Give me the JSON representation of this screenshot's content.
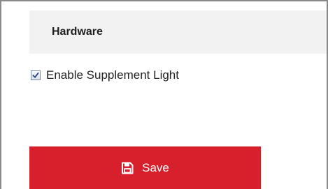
{
  "section": {
    "title": "Hardware"
  },
  "options": {
    "supplement_light": {
      "label": "Enable Supplement Light",
      "checked": true
    }
  },
  "actions": {
    "save_label": "Save",
    "save_icon": "floppy-disk-icon"
  },
  "colors": {
    "save_button_bg": "#d7202b",
    "header_bg": "#f2f2f2",
    "checkmark": "#2a3f7e"
  }
}
